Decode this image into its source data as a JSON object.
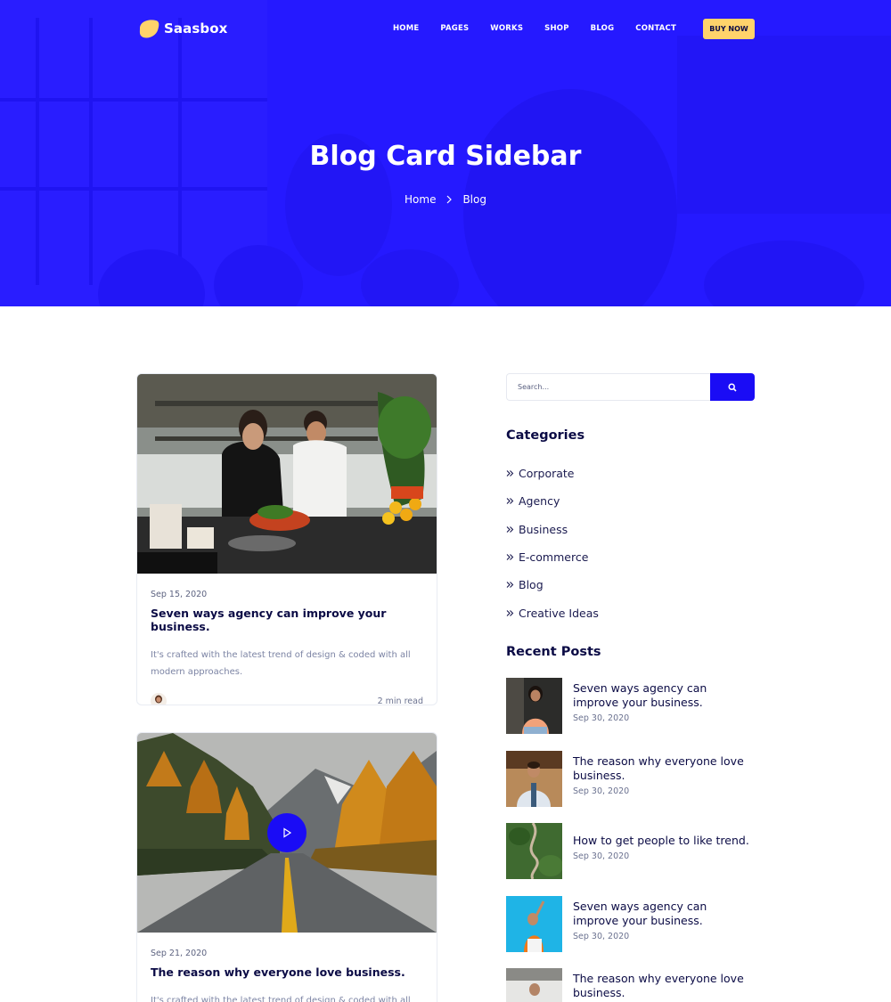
{
  "header": {
    "brand": "Saasbox",
    "menu": [
      "HOME",
      "PAGES",
      "WORKS",
      "SHOP",
      "BLOG",
      "CONTACT"
    ],
    "cta": "BUY NOW"
  },
  "hero": {
    "title": "Blog Card Sidebar",
    "breadcrumb": [
      "Home",
      "Blog"
    ]
  },
  "posts": [
    {
      "date": "Sep 15, 2020",
      "title": "Seven ways agency can improve your business.",
      "excerpt": "It's crafted with the latest trend of design & coded with all modern approaches.",
      "read_time": "2 min read"
    },
    {
      "date": "Sep 21, 2020",
      "title": "The reason why everyone love business.",
      "excerpt": "It's crafted with the latest trend of design & coded with all"
    }
  ],
  "sidebar": {
    "search_placeholder": "Search...",
    "categories_title": "Categories",
    "categories": [
      "Corporate",
      "Agency",
      "Business",
      "E-commerce",
      "Blog",
      "Creative Ideas"
    ],
    "recent_title": "Recent Posts",
    "recent": [
      {
        "title": "Seven ways agency can improve your business.",
        "date": "Sep 30, 2020"
      },
      {
        "title": "The reason why everyone love business.",
        "date": "Sep 30, 2020"
      },
      {
        "title": "How to get people to like trend.",
        "date": "Sep 30, 2020"
      },
      {
        "title": "Seven ways agency can improve your business.",
        "date": "Sep 30, 2020"
      },
      {
        "title": "The reason why everyone love business.",
        "date": ""
      }
    ]
  },
  "colors": {
    "primary": "#1a0cf5",
    "accent": "#ffd36b",
    "heading": "#0b0b45"
  }
}
